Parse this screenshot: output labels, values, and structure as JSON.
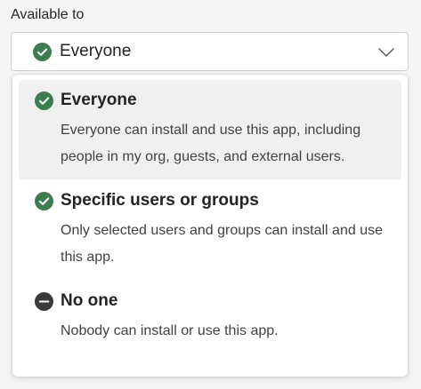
{
  "field": {
    "label": "Available to",
    "selected_value": "Everyone",
    "selected_icon": "check-circle-icon",
    "dropdown_icon": "chevron-down-icon"
  },
  "options": [
    {
      "title": "Everyone",
      "description": "Everyone can install and use this app, including people in my org, guests, and external users.",
      "icon": "check-circle-icon",
      "selected": true
    },
    {
      "title": "Specific users or groups",
      "description": "Only selected users and groups can install and use this app.",
      "icon": "check-circle-icon",
      "selected": false
    },
    {
      "title": "No one",
      "description": "Nobody can install or use this app.",
      "icon": "minus-circle-icon",
      "selected": false
    }
  ],
  "colors": {
    "check_green": "#3c7d4f",
    "minus_dark": "#3b3b3b",
    "selected_bg": "#f0f0f0"
  }
}
